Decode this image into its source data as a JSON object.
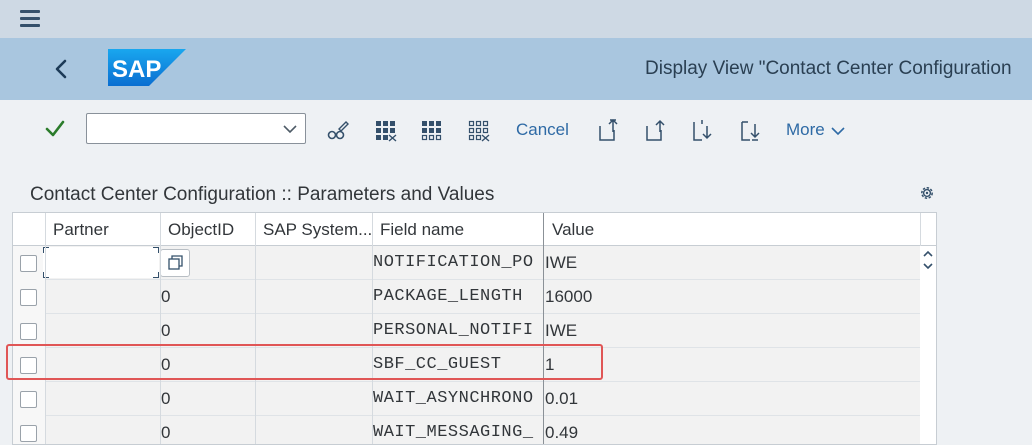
{
  "header": {
    "title": "Display View \"Contact Center Configuration",
    "logo_text": "SAP"
  },
  "toolbar": {
    "combo_value": "",
    "cancel_label": "Cancel",
    "more_label": "More"
  },
  "table": {
    "title": "Contact Center Configuration :: Parameters and Values",
    "columns": [
      "Partner",
      "ObjectID",
      "SAP System...",
      "Field name",
      "Value"
    ],
    "rows": [
      {
        "partner": "",
        "object_id": "",
        "sap_system": "",
        "field_name": "NOTIFICATION_PO",
        "value": "IWE"
      },
      {
        "partner": "",
        "object_id": "0",
        "sap_system": "",
        "field_name": "PACKAGE_LENGTH",
        "value": "16000"
      },
      {
        "partner": "",
        "object_id": "0",
        "sap_system": "",
        "field_name": "PERSONAL_NOTIFI",
        "value": "IWE"
      },
      {
        "partner": "",
        "object_id": "0",
        "sap_system": "",
        "field_name": "SBF_CC_GUEST",
        "value": "1"
      },
      {
        "partner": "",
        "object_id": "0",
        "sap_system": "",
        "field_name": "WAIT_ASYNCHRONO",
        "value": "0.01"
      },
      {
        "partner": "",
        "object_id": "0",
        "sap_system": "",
        "field_name": "WAIT_MESSAGING_",
        "value": "0.49"
      }
    ]
  },
  "colors": {
    "brand": "#0a6ed1",
    "title_bar": "#a9c6df",
    "highlight": "#e05656",
    "accept": "#2b7c2b"
  }
}
